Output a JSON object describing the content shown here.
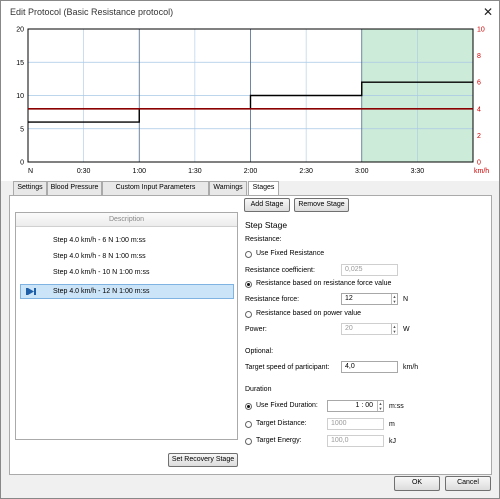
{
  "window": {
    "title": "Edit Protocol (Basic Resistance protocol)",
    "close_glyph": "✕"
  },
  "chart_data": {
    "type": "line",
    "x_tick_labels": [
      "N",
      "0:30",
      "1:00",
      "1:30",
      "2:00",
      "2:30",
      "3:00",
      "3:30"
    ],
    "x_unit": "km/h",
    "y_left_ticks": [
      "20",
      "15",
      "10",
      "5",
      "0"
    ],
    "y_right_ticks": [
      "10",
      "8",
      "6",
      "4",
      "2",
      "0"
    ],
    "ylim_left": [
      0,
      20
    ],
    "ylim_right": [
      0,
      10
    ],
    "grid": true,
    "highlight_x_range": [
      180,
      240
    ],
    "series": [
      {
        "axis": "left",
        "color": "#000000",
        "steps": [
          {
            "x0": 0,
            "x1": 60,
            "y": 6
          },
          {
            "x0": 60,
            "x1": 120,
            "y": 8
          },
          {
            "x0": 120,
            "x1": 180,
            "y": 10
          },
          {
            "x0": 180,
            "x1": 240,
            "y": 12
          }
        ]
      },
      {
        "axis": "right",
        "color": "#8b0000",
        "steps": [
          {
            "x0": 0,
            "x1": 240,
            "y": 4
          }
        ]
      }
    ],
    "colors": {
      "highlight": "#ccebd9",
      "right_axis": "#cc0000",
      "grid_blue": "#a8c8e6"
    }
  },
  "tabs": [
    {
      "label": "Settings"
    },
    {
      "label": "Blood Pressure"
    },
    {
      "label": "Custom Input Parameters"
    },
    {
      "label": "Warnings"
    },
    {
      "label": "Stages",
      "active": true
    }
  ],
  "stages_panel": {
    "add_stage": "Add Stage",
    "remove_stage": "Remove Stage",
    "list_header": "Description",
    "items": [
      "Step 4.0 km/h - 6 N 1:00 m:ss",
      "Step 4.0 km/h - 8 N 1:00 m:ss",
      "Step 4.0 km/h - 10 N 1:00 m:ss",
      "Step 4.0 km/h - 12 N 1:00 m:ss"
    ],
    "selected_index": 3,
    "set_recovery": "Set Recovery Stage"
  },
  "step": {
    "heading": "Step Stage",
    "resistance_label": "Resistance:",
    "use_fixed_resistance": "Use Fixed Resistance",
    "resistance_coefficient_label": "Resistance coefficient:",
    "resistance_coefficient_value": "0,025",
    "based_on_force": "Resistance based on resistance force value",
    "resistance_force_label": "Resistance force:",
    "resistance_force_value": "12",
    "force_unit": "N",
    "based_on_power": "Resistance based on power value",
    "power_label": "Power:",
    "power_value": "20",
    "power_unit": "W",
    "optional_label": "Optional:",
    "target_speed_label": "Target speed of participant:",
    "target_speed_value": "4,0",
    "speed_unit": "km/h",
    "duration_label": "Duration",
    "use_fixed_duration": "Use Fixed Duration:",
    "fixed_duration_value": "1 : 00",
    "duration_unit": "m:ss",
    "target_distance_label": "Target Distance:",
    "target_distance_value": "1000",
    "distance_unit": "m",
    "target_energy_label": "Target Energy:",
    "target_energy_value": "100,0",
    "energy_unit": "kJ"
  },
  "footer": {
    "ok": "OK",
    "cancel": "Cancel"
  }
}
